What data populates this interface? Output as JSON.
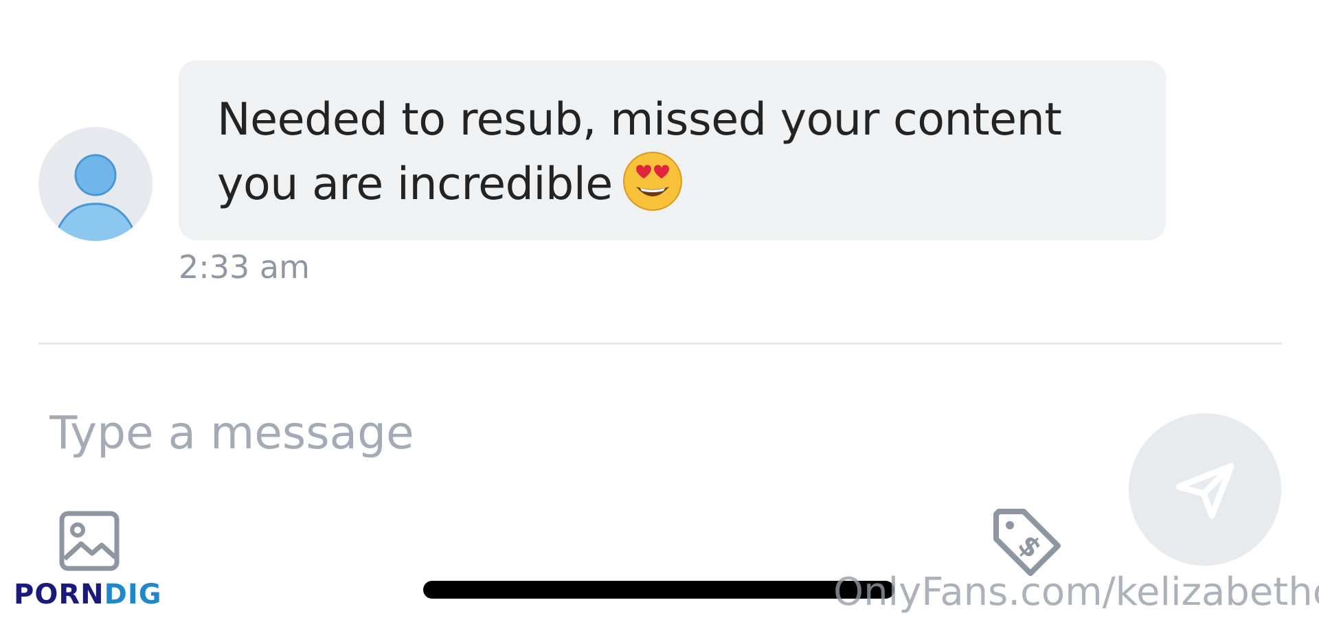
{
  "chat": {
    "message": {
      "text": "Needed to resub, missed your content you are incredible",
      "line_1": "Needed to resub, missed your content",
      "line_2": "you are incredible",
      "emoji": "smiling-face-with-heart-eyes",
      "timestamp": "2:33 am"
    }
  },
  "composer": {
    "placeholder": "Type a message",
    "value": ""
  },
  "toolbar": {
    "icons": [
      "image-icon",
      "price-tag-icon",
      "send-icon"
    ]
  },
  "watermarks": {
    "site_part_1": "PORN",
    "site_part_2": "DIG",
    "source": "OnlyFans.com/kelizabethc"
  },
  "colors": {
    "bubble": "#f0f1f3",
    "timestamp": "#8f97a3",
    "avatar_bg": "#e6e9ee",
    "avatar_figure": "#6fb7ea",
    "icon_gray": "#8e96a1",
    "send_bg": "#e8ebee",
    "watermark_dark": "#1a1a7a",
    "watermark_light": "#1e88c8"
  }
}
